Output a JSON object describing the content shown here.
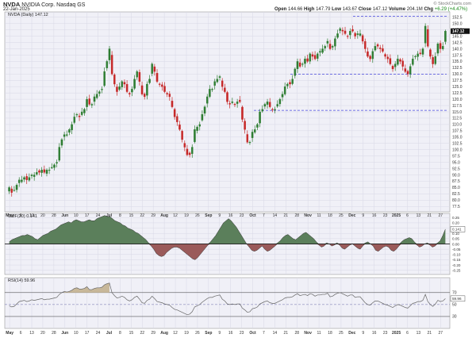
{
  "header": {
    "symbol": "NVDA",
    "name": "NVIDIA Corp.  Nasdaq GS",
    "date": "22-Jan-2025",
    "watermark": "© StockCharts.com",
    "quote": {
      "open_label": "Open",
      "open": "144.66",
      "high_label": "High",
      "high": "147.79",
      "low_label": "Low",
      "low": "143.67",
      "close_label": "Close",
      "close": "147.12",
      "volume_label": "Volume",
      "volume": "204.1M",
      "chg_label": "Chg",
      "chg": "+6.29 (+4.47%)"
    }
  },
  "colors": {
    "panel_bg": "#f0f0f7",
    "up": "#2e7d32",
    "down": "#c62828",
    "cmf_pos": "#5b7f5b",
    "cmf_neg": "#9a5a5a",
    "rsi_line": "#666666",
    "ref_line": "#4a4adf"
  },
  "chart_data": [
    {
      "type": "candlestick",
      "title": "NVDA (Daily) 147.12",
      "last_value": "147.12",
      "x_tick_labels": [
        "May",
        "6",
        "13",
        "20",
        "28",
        "Jun",
        "10",
        "17",
        "24",
        "Jul",
        "8",
        "15",
        "22",
        "29",
        "Aug",
        "12",
        "19",
        "26",
        "Sep",
        "9",
        "16",
        "23",
        "Oct",
        "7",
        "14",
        "21",
        "28",
        "Nov",
        "11",
        "18",
        "25",
        "Dec",
        "9",
        "16",
        "23",
        "2025",
        "6",
        "13",
        "21",
        "27"
      ],
      "y_tick_labels": [
        "77.5",
        "80.0",
        "82.5",
        "85.0",
        "87.5",
        "90.0",
        "92.5",
        "95.0",
        "97.5",
        "100.0",
        "102.5",
        "105.0",
        "107.5",
        "110.0",
        "112.5",
        "115.0",
        "117.5",
        "120.0",
        "122.5",
        "125.0",
        "127.5",
        "130.0",
        "132.5",
        "135.0",
        "137.5",
        "140.0",
        "142.5",
        "145.0",
        "147.5",
        "150.0",
        "152.5"
      ],
      "ylim": [
        76,
        154
      ],
      "reference_lines": [
        152.9,
        129.9,
        115.6
      ],
      "close": [
        85,
        83,
        84,
        86,
        88,
        88,
        89,
        88,
        89,
        90,
        90,
        91,
        91,
        92,
        91,
        92,
        92,
        93,
        94,
        95,
        101,
        104,
        106,
        106,
        108,
        110,
        113,
        114,
        113,
        115,
        116,
        120,
        118,
        118,
        121,
        122,
        123,
        124,
        131,
        135,
        140,
        130,
        126,
        123,
        125,
        127,
        126,
        123,
        122,
        124,
        128,
        131,
        127,
        122,
        121,
        126,
        128,
        134,
        131,
        127,
        126,
        125,
        123,
        122,
        121,
        117,
        113,
        111,
        108,
        104,
        101,
        98,
        98,
        101,
        108,
        109,
        110,
        114,
        117,
        121,
        124,
        124,
        127,
        128,
        129,
        125,
        123,
        119,
        118,
        119,
        118,
        119,
        119,
        112,
        108,
        103,
        103,
        107,
        108,
        110,
        115,
        116,
        118,
        119,
        117,
        116,
        116,
        118,
        120,
        122,
        125,
        126,
        126,
        128,
        132,
        135,
        133,
        134,
        136,
        135,
        138,
        137,
        136,
        138,
        139,
        140,
        141,
        143,
        140,
        141,
        144,
        146,
        148,
        147,
        146,
        145,
        147,
        147,
        145,
        146,
        146,
        143,
        140,
        137,
        136,
        139,
        141,
        141,
        140,
        139,
        137,
        136,
        134,
        132,
        134,
        136,
        135,
        133,
        131,
        130,
        133,
        136,
        137,
        138,
        138,
        140,
        149,
        141,
        137,
        134,
        137,
        142,
        140,
        141,
        147
      ],
      "ohlc_count": 173
    },
    {
      "type": "area",
      "title": "CMF(20) 0.141",
      "last_value": "0.141",
      "y_tick_labels": [
        "0.25",
        "0.20",
        "0.15",
        "0.10",
        "0.05",
        "0.00",
        "-0.05",
        "-0.10",
        "-0.15",
        "-0.20",
        "-0.25"
      ],
      "ylim": [
        -0.29,
        0.29
      ],
      "values": [
        0.02,
        0.04,
        0.05,
        0.06,
        0.07,
        0.08,
        0.08,
        0.09,
        0.08,
        0.07,
        0.05,
        0.04,
        0.06,
        0.08,
        0.09,
        0.1,
        0.12,
        0.13,
        0.14,
        0.16,
        0.18,
        0.19,
        0.2,
        0.21,
        0.2,
        0.22,
        0.23,
        0.22,
        0.21,
        0.21,
        0.22,
        0.23,
        0.22,
        0.22,
        0.24,
        0.25,
        0.26,
        0.27,
        0.26,
        0.26,
        0.24,
        0.22,
        0.21,
        0.2,
        0.18,
        0.17,
        0.15,
        0.14,
        0.13,
        0.11,
        0.1,
        0.08,
        0.06,
        0.04,
        0.01,
        -0.02,
        -0.05,
        -0.09,
        -0.11,
        -0.12,
        -0.11,
        -0.08,
        -0.06,
        -0.04,
        -0.03,
        -0.03,
        -0.04,
        -0.06,
        -0.08,
        -0.1,
        -0.12,
        -0.14,
        -0.15,
        -0.13,
        -0.1,
        -0.07,
        -0.04,
        -0.01,
        0.02,
        0.05,
        0.08,
        0.12,
        0.16,
        0.2,
        0.22,
        0.24,
        0.22,
        0.19,
        0.16,
        0.12,
        0.08,
        0.04,
        0.0,
        -0.03,
        -0.06,
        -0.07,
        -0.06,
        -0.04,
        -0.02,
        -0.05,
        -0.07,
        -0.06,
        -0.04,
        -0.02,
        0.01,
        0.03,
        0.06,
        0.08,
        0.09,
        0.07,
        0.05,
        0.04,
        0.06,
        0.08,
        0.1,
        0.11,
        0.09,
        0.07,
        0.05,
        0.02,
        -0.01,
        -0.03,
        -0.02,
        0.01,
        0.0,
        -0.02,
        -0.01,
        0.01,
        -0.01,
        -0.04,
        -0.05,
        -0.03,
        -0.01,
        0.0,
        -0.02,
        -0.04,
        -0.05,
        -0.02,
        0.01,
        0.02,
        0.0,
        -0.02,
        -0.06,
        -0.07,
        -0.05,
        -0.03,
        -0.02,
        -0.03,
        -0.06,
        -0.07,
        -0.05,
        -0.02,
        0.02,
        0.04,
        0.05,
        0.06,
        0.05,
        0.02,
        -0.01,
        -0.03,
        -0.02,
        0.0,
        0.01,
        -0.01,
        -0.03,
        -0.02,
        0.01,
        0.03,
        0.08,
        0.14
      ]
    },
    {
      "type": "line",
      "title": "RSI(14) 59.96",
      "last_value": "59.96",
      "y_tick_labels": [
        "70",
        "50",
        "30"
      ],
      "ylim": [
        10,
        95
      ],
      "overbought": 70,
      "oversold": 30,
      "values": [
        48,
        46,
        47,
        51,
        55,
        56,
        57,
        55,
        56,
        58,
        57,
        58,
        59,
        60,
        58,
        59,
        59,
        60,
        61,
        62,
        67,
        70,
        72,
        71,
        72,
        74,
        77,
        78,
        76,
        76,
        77,
        80,
        75,
        75,
        77,
        78,
        78,
        79,
        83,
        85,
        86,
        70,
        65,
        61,
        62,
        64,
        62,
        58,
        56,
        58,
        62,
        64,
        59,
        53,
        52,
        57,
        59,
        64,
        60,
        55,
        54,
        53,
        51,
        50,
        49,
        45,
        42,
        41,
        39,
        37,
        35,
        33,
        34,
        38,
        46,
        48,
        50,
        54,
        57,
        60,
        62,
        62,
        64,
        65,
        66,
        59,
        56,
        51,
        50,
        51,
        50,
        51,
        51,
        44,
        41,
        37,
        38,
        43,
        44,
        46,
        51,
        53,
        55,
        56,
        53,
        52,
        52,
        54,
        56,
        58,
        61,
        62,
        62,
        63,
        66,
        68,
        65,
        66,
        67,
        65,
        68,
        67,
        64,
        66,
        66,
        67,
        67,
        69,
        63,
        64,
        67,
        69,
        70,
        68,
        66,
        64,
        66,
        66,
        62,
        63,
        63,
        58,
        53,
        50,
        49,
        53,
        56,
        56,
        54,
        52,
        50,
        49,
        47,
        45,
        48,
        50,
        49,
        47,
        45,
        44,
        48,
        52,
        53,
        55,
        55,
        57,
        67,
        55,
        50,
        47,
        51,
        57,
        55,
        56,
        60
      ]
    }
  ]
}
